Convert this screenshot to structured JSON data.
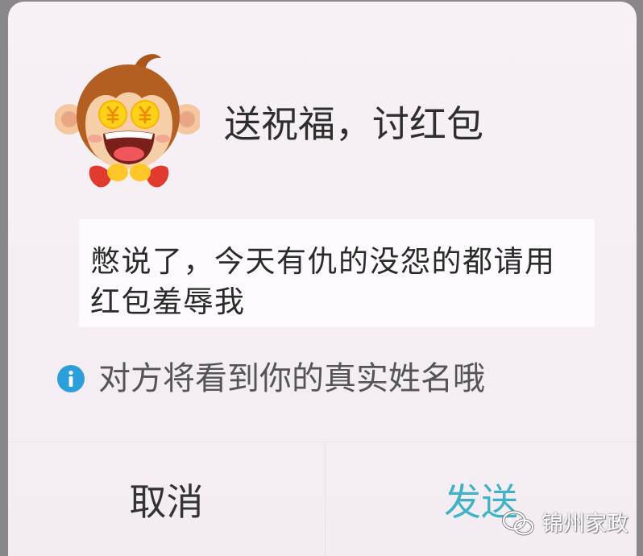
{
  "dialog": {
    "avatar_icon": "monkey-mascot-icon",
    "title": "送祝福，讨红包",
    "message_lines": [
      "憋说了，今天有仇的没怨的都请用",
      "红包羞辱我"
    ],
    "notice": {
      "icon": "info-icon",
      "text": "对方将看到你的真实姓名哦"
    },
    "buttons": {
      "cancel": "取消",
      "send": "发送"
    }
  },
  "watermark": {
    "icon": "wechat-icon",
    "text": "锦州家政"
  },
  "colors": {
    "dialog_bg": "#f4eef4",
    "send_accent": "#3fb2c6",
    "info_blue": "#2b9fda",
    "text_primary": "#333333"
  }
}
